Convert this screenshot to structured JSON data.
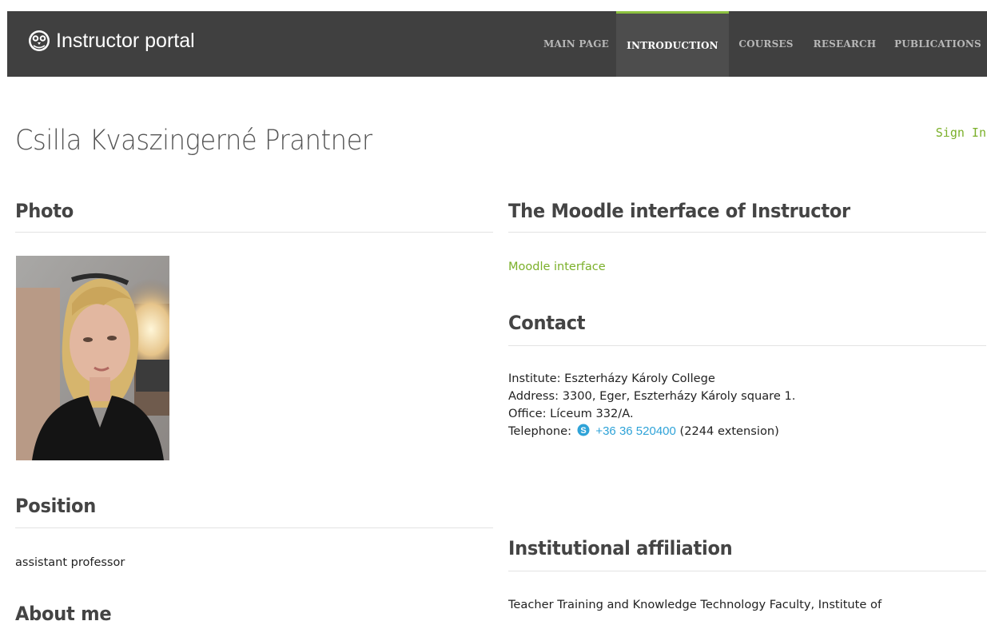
{
  "header": {
    "logo_text": "Instructor portal",
    "nav": [
      {
        "label": "MAIN PAGE",
        "active": false
      },
      {
        "label": "INTRODUCTION",
        "active": true
      },
      {
        "label": "COURSES",
        "active": false
      },
      {
        "label": "RESEARCH",
        "active": false
      },
      {
        "label": "PUBLICATIONS",
        "active": false
      }
    ]
  },
  "page": {
    "name": "Csilla Kvaszingerné Prantner",
    "sign_in": "Sign In"
  },
  "left": {
    "photo_title": "Photo",
    "position_title": "Position",
    "position_value": "assistant professor",
    "about_title": "About me"
  },
  "right": {
    "moodle_title": "The Moodle interface of Instructor",
    "moodle_link": "Moodle interface",
    "contact_title": "Contact",
    "contact": {
      "institute_label": "Institute:",
      "institute_value": "Eszterházy Károly College",
      "address_label": "Address:",
      "address_value": "3300, Eger, Eszterházy Károly square 1.",
      "office_label": "Office:",
      "office_value": "Líceum 332/A.",
      "telephone_label": "Telephone:",
      "telephone_value": "+36 36 520400",
      "telephone_extension": "(2244 extension)"
    },
    "affiliation_title": "Institutional affiliation",
    "affiliation_text": "Teacher Training and Knowledge Technology Faculty, Institute of"
  },
  "colors": {
    "accent": "#8cc13f",
    "link": "#7bb02a",
    "skype": "#2fa3d8",
    "topbar": "#404040"
  },
  "icons": {
    "logo": "owl-logo-icon",
    "telephone": "skype-icon"
  }
}
